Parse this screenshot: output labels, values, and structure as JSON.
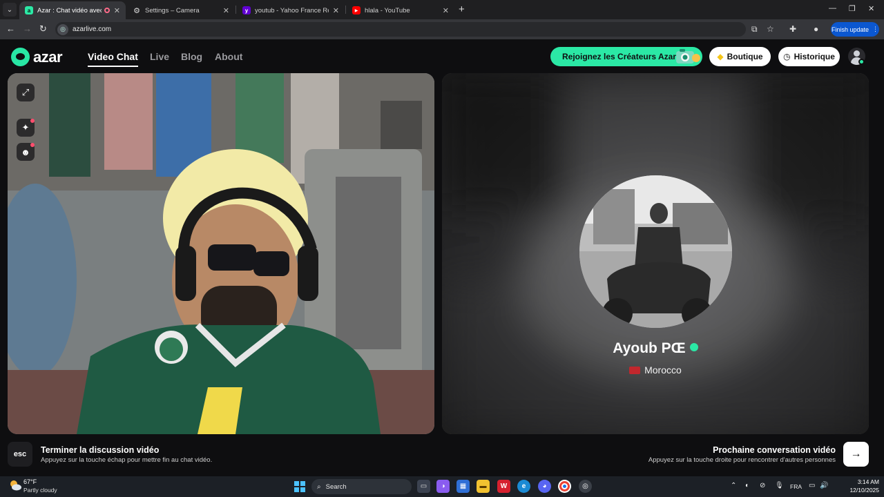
{
  "browser": {
    "tabs": [
      {
        "title": "Azar : Chat vidéo avec de n",
        "active": true
      },
      {
        "title": "Settings – Camera",
        "active": false
      },
      {
        "title": "youtub - Yahoo France Résultat",
        "active": false
      },
      {
        "title": "hlala - YouTube",
        "active": false
      }
    ],
    "url": "azarlive.com",
    "finish_update_label": "Finish update"
  },
  "header": {
    "logo_text": "azar",
    "nav": [
      "Video Chat",
      "Live",
      "Blog",
      "About"
    ],
    "creators_label": "Rejoignez les Créateurs Azar",
    "boutique_label": "Boutique",
    "history_label": "Historique"
  },
  "match": {
    "name": "Ayoub PŒ",
    "country": "Morocco"
  },
  "hints": {
    "esc_key": "esc",
    "end_title": "Terminer la discussion vidéo",
    "end_sub": "Appuyez sur la touche échap pour mettre fin au chat vidéo.",
    "next_title": "Prochaine conversation vidéo",
    "next_sub": "Appuyez sur la touche droite pour rencontrer d'autres personnes",
    "next_key": "→"
  },
  "taskbar": {
    "temperature": "67°F",
    "weather": "Partly cloudy",
    "search_placeholder": "Search",
    "language": "FRA",
    "time": "3:14 AM",
    "date": "12/10/2025"
  },
  "colors": {
    "accent": "#2be8a5",
    "background": "#0e0e10",
    "chrome_blue": "#0b57d0"
  }
}
